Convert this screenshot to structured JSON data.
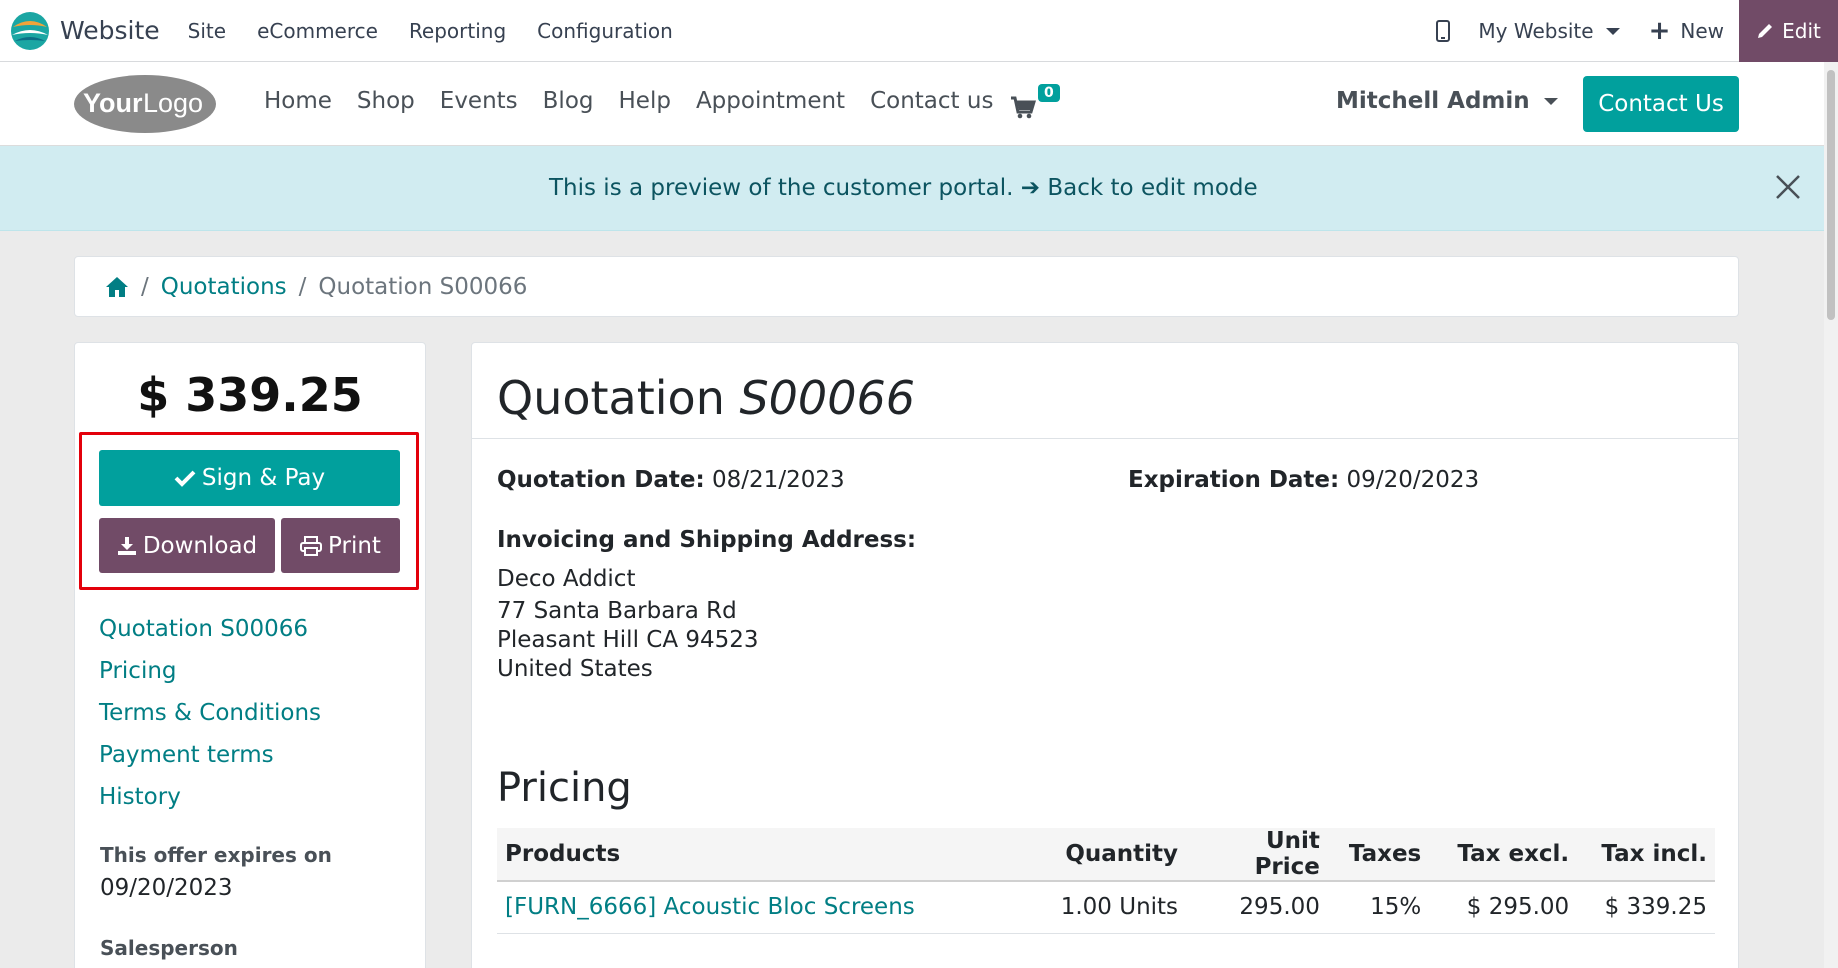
{
  "topbar": {
    "app_name": "Website",
    "menu": [
      "Site",
      "eCommerce",
      "Reporting",
      "Configuration"
    ],
    "website_selector": "My Website",
    "new_label": "New",
    "edit_label": "Edit",
    "edit_color": "#714b67"
  },
  "header": {
    "logo_text": "YourLogo",
    "nav": [
      "Home",
      "Shop",
      "Events",
      "Blog",
      "Help",
      "Appointment",
      "Contact us"
    ],
    "cart_count": "0",
    "user": "Mitchell Admin",
    "contact_button": "Contact Us",
    "accent": "#01a09d"
  },
  "alert": {
    "message": "This is a preview of the customer portal.",
    "link": "Back to edit mode"
  },
  "breadcrumb": {
    "items": [
      "Quotations"
    ],
    "active": "Quotation S00066"
  },
  "sidebar": {
    "amount": "$ 339.25",
    "sign_pay_label": "Sign & Pay",
    "download_label": "Download",
    "print_label": "Print",
    "links": [
      "Quotation S00066",
      "Pricing",
      "Terms & Conditions",
      "Payment terms",
      "History"
    ],
    "expires_label": "This offer expires on",
    "expires_date": "09/20/2023",
    "salesperson_label": "Salesperson"
  },
  "document": {
    "title_prefix": "Quotation",
    "title_number": "S00066",
    "quotation_date_label": "Quotation Date:",
    "quotation_date": "08/21/2023",
    "expiration_date_label": "Expiration Date:",
    "expiration_date": "09/20/2023",
    "address_label": "Invoicing and Shipping Address:",
    "address_name": "Deco Addict",
    "address_line1": "77 Santa Barbara Rd",
    "address_line2": "Pleasant Hill CA 94523",
    "address_country": "United States",
    "pricing_title": "Pricing",
    "table": {
      "headers": [
        "Products",
        "Quantity",
        "Unit Price",
        "Taxes",
        "Tax excl.",
        "Tax incl."
      ],
      "rows": [
        [
          "[FURN_6666] Acoustic Bloc Screens",
          "1.00 Units",
          "295.00",
          "15%",
          "$ 295.00",
          "$ 339.25"
        ]
      ]
    }
  }
}
